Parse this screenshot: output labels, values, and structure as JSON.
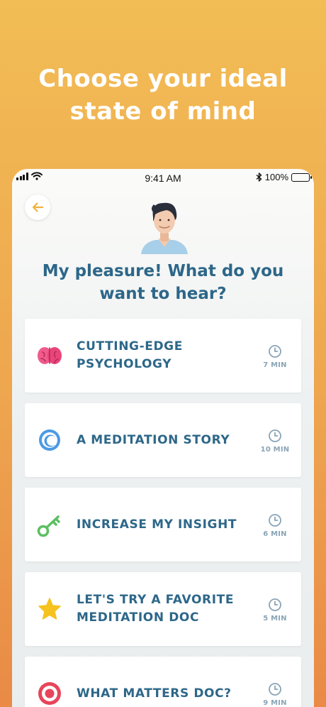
{
  "headline": {
    "line1": "Choose your ideal",
    "line2": "state of mind"
  },
  "status_bar": {
    "time": "9:41 AM",
    "battery": "100%"
  },
  "question": {
    "line1": "My pleasure! What do you",
    "line2": "want to hear?"
  },
  "options": [
    {
      "label_line1": "CUTTING-EDGE",
      "label_line2": "PSYCHOLOGY",
      "duration": "7 MIN",
      "icon": "brain-icon",
      "color": "#e8457a"
    },
    {
      "label_line1": "A MEDITATION STORY",
      "label_line2": "",
      "duration": "10 MIN",
      "icon": "ring-icon",
      "color": "#3f8fe0"
    },
    {
      "label_line1": "INCREASE MY INSIGHT",
      "label_line2": "",
      "duration": "6 MIN",
      "icon": "key-icon",
      "color": "#5cbf63"
    },
    {
      "label_line1": "LET'S TRY A FAVORITE",
      "label_line2": "MEDITATION DOC",
      "duration": "5 MIN",
      "icon": "star-icon",
      "color": "#f6c21f"
    },
    {
      "label_line1": "WHAT MATTERS DOC?",
      "label_line2": "",
      "duration": "9 MIN",
      "icon": "target-icon",
      "color": "#e8455a"
    }
  ]
}
